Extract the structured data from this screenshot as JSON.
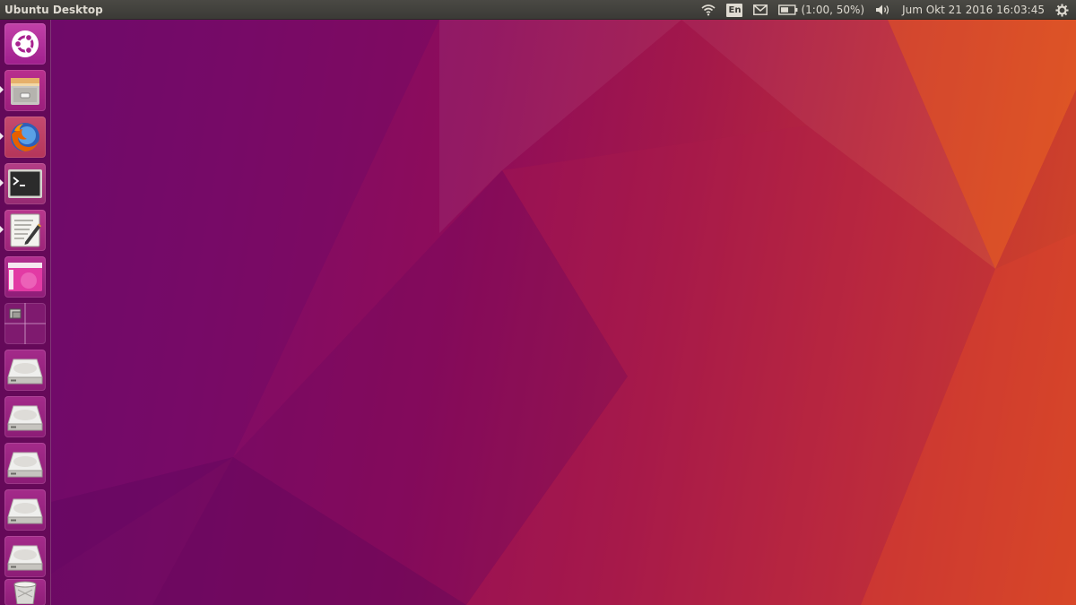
{
  "panel": {
    "title": "Ubuntu Desktop",
    "keyboard_layout": "En",
    "battery_text": "(1:00, 50%)",
    "clock": "Jum Okt 21 2016 16:03:45"
  },
  "indicators": {
    "icons": [
      "wifi-icon",
      "keyboard-layout-indicator",
      "mail-icon",
      "battery-icon",
      "volume-icon",
      "system-gear-icon"
    ]
  },
  "launcher": {
    "items": [
      {
        "name": "ubuntu-dash-button",
        "icon": "ubuntu-logo-icon",
        "running": false
      },
      {
        "name": "files-launcher",
        "icon": "file-cabinet-icon",
        "running": true
      },
      {
        "name": "firefox-launcher",
        "icon": "firefox-icon",
        "running": true
      },
      {
        "name": "terminal-launcher",
        "icon": "terminal-icon",
        "running": true
      },
      {
        "name": "text-editor-launcher",
        "icon": "text-editor-icon",
        "running": true
      },
      {
        "name": "software-launcher",
        "icon": "window-app-icon",
        "running": false
      },
      {
        "name": "workspace-switcher",
        "icon": "workspace-grid-icon",
        "running": false
      },
      {
        "name": "drive-launcher-1",
        "icon": "hard-drive-icon",
        "running": false
      },
      {
        "name": "drive-launcher-2",
        "icon": "hard-drive-icon",
        "running": false
      },
      {
        "name": "drive-launcher-3",
        "icon": "hard-drive-icon",
        "running": false
      },
      {
        "name": "drive-launcher-4",
        "icon": "hard-drive-icon",
        "running": false
      },
      {
        "name": "drive-launcher-5",
        "icon": "hard-drive-icon",
        "running": false
      },
      {
        "name": "trash-launcher",
        "icon": "trash-icon",
        "running": false
      }
    ]
  },
  "colors": {
    "panel_bg": "#3b3a36",
    "panel_text": "#dfdbd2",
    "wallpaper_left": "#6e0a6c",
    "wallpaper_right": "#d44a24"
  }
}
